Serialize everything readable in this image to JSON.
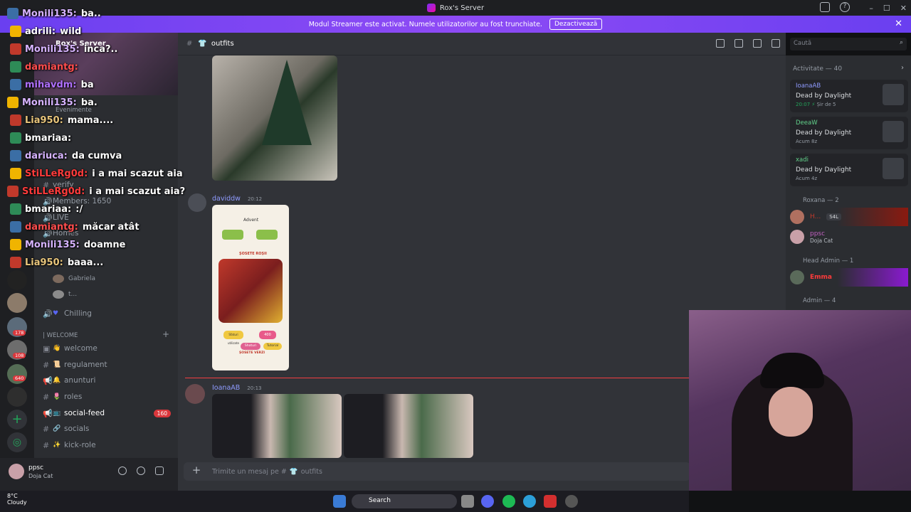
{
  "window": {
    "title": "Rox's Server"
  },
  "banner": {
    "text": "Modul Streamer este activat. Numele utilizatorilor au fost trunchiate.",
    "button_label": "Dezactivează"
  },
  "server": {
    "name": "Rox's Server",
    "events_label": "Evenimente"
  },
  "rail": {
    "badges": [
      "178",
      "108",
      "640"
    ]
  },
  "sidebar": {
    "channels_top": [
      {
        "label": "verify"
      },
      {
        "label": "Members: 1650"
      },
      {
        "label": "LIVE"
      },
      {
        "label": "Homes"
      }
    ],
    "voice_users": [
      "Gabriela",
      "t..."
    ],
    "voice_channel": "Chilling",
    "category_label": "| WELCOME",
    "channels": [
      {
        "emoji": "👋",
        "label": "welcome",
        "active": false
      },
      {
        "emoji": "📜",
        "label": "regulament",
        "active": false
      },
      {
        "emoji": "🔔",
        "label": "anunturi",
        "active": false
      },
      {
        "emoji": "🌷",
        "label": "roles",
        "active": false
      },
      {
        "emoji": "📺",
        "label": "social-feed",
        "active": true,
        "count": "160"
      },
      {
        "emoji": "🔗",
        "label": "socials",
        "active": false
      },
      {
        "emoji": "✨",
        "label": "kick-role",
        "active": false
      }
    ]
  },
  "user_panel": {
    "name": "ppsc",
    "status": "Doja Cat"
  },
  "channel": {
    "name": "outfits",
    "composer_placeholder": "Trimite un mesaj pe #",
    "composer_channel": "outfits",
    "search_placeholder": "Caută"
  },
  "messages": [
    {
      "author": "daviddw",
      "time": "20:12"
    },
    {
      "author": "IoanaAB",
      "time": "20:13"
    }
  ],
  "phone_screen": {
    "header": "Advent",
    "title": "ȘOSETE ROȘII",
    "buttons": [
      "Sfaturi utilizate",
      "400",
      "Shoturi",
      "Tutorial"
    ],
    "footer": "ȘOSETE VERZI"
  },
  "members": {
    "activity_title": "Activitate — 40",
    "activity_cards": [
      {
        "name": "IoanaAB",
        "game": "Dead by Daylight",
        "sub": "20:07",
        "extra": "Șir de 5"
      },
      {
        "name": "DeeaW",
        "game": "Dead by Daylight",
        "sub": "Acum 8z"
      },
      {
        "name": "xadi",
        "game": "Dead by Daylight",
        "sub": "Acum 4z"
      }
    ],
    "roles": [
      {
        "label": "Roxana — 2"
      },
      {
        "label": "Head Admin — 1"
      },
      {
        "label": "Admin — 4"
      }
    ],
    "member_items": [
      {
        "name": "H...",
        "tag": "S4L"
      },
      {
        "name": "ppsc",
        "desc": "Doja Cat"
      },
      {
        "name": "Emma"
      }
    ]
  },
  "overlay_chat": [
    {
      "user": "Monili135:",
      "msg": "ba..",
      "color": "#d6b3ff"
    },
    {
      "user": "adrili:",
      "msg": "wild",
      "color": "#ffffff"
    },
    {
      "user": "Monili135:",
      "msg": "inca?..",
      "color": "#d6b3ff"
    },
    {
      "user": "damiantg:",
      "msg": "",
      "color": "#ff4d4d"
    },
    {
      "user": "mihavdm:",
      "msg": "ba",
      "color": "#b070ff"
    },
    {
      "user": "Monili135:",
      "msg": "ba.",
      "color": "#d6b3ff"
    },
    {
      "user": "Lia950:",
      "msg": "mama....",
      "color": "#e8c57b"
    },
    {
      "user": "bmariaa:",
      "msg": "",
      "color": "#ffffff"
    },
    {
      "user": "dariuca:",
      "msg": "da cumva",
      "color": "#d6b3ff"
    },
    {
      "user": "StiLLeRg0d:",
      "msg": "i a mai scazut aia",
      "color": "#ff3b3b"
    },
    {
      "user": "StiLLeRg0d:",
      "msg": "i a mai scazut aia?",
      "color": "#ff3b3b"
    },
    {
      "user": "bmariaa:",
      "msg": ":/",
      "color": "#ffffff"
    },
    {
      "user": "damiantg:",
      "msg": "măcar atât",
      "color": "#ff4d4d"
    },
    {
      "user": "Monili135:",
      "msg": "doamne",
      "color": "#d6b3ff"
    },
    {
      "user": "Lia950:",
      "msg": "baaa...",
      "color": "#e8c57b"
    }
  ],
  "taskbar": {
    "temp": "8°C",
    "weather": "Cloudy",
    "search_label": "Search"
  }
}
